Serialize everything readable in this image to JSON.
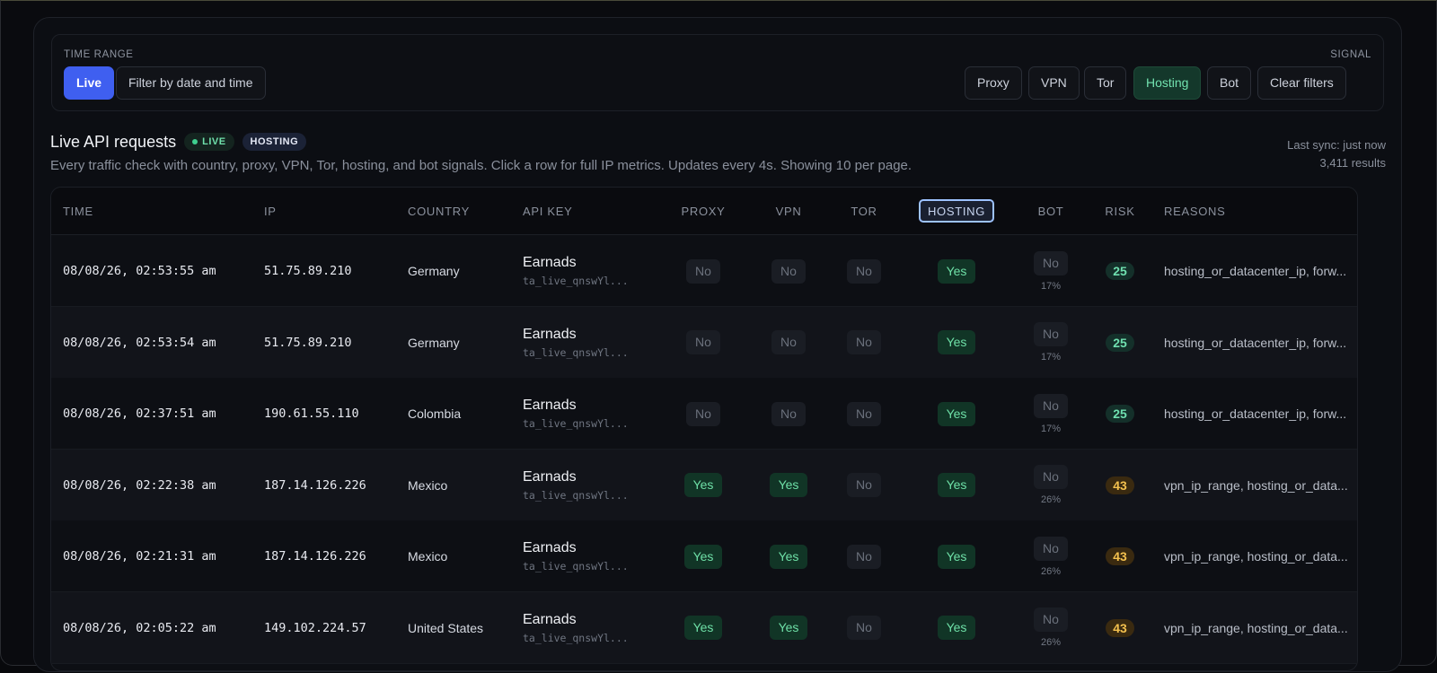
{
  "filters": {
    "time_range_label": "TIME RANGE",
    "signal_label": "SIGNAL",
    "live_button": "Live",
    "date_button": "Filter by date and time",
    "signals": [
      "Proxy",
      "VPN",
      "Tor",
      "Hosting",
      "Bot"
    ],
    "active_signal": "Hosting",
    "clear_button": "Clear filters"
  },
  "header": {
    "title": "Live API requests",
    "live_pill": "LIVE",
    "filter_pill": "HOSTING",
    "description": "Every traffic check with country, proxy, VPN, Tor, hosting, and bot signals. Click a row for full IP metrics. Updates every 4s. Showing 10 per page.",
    "last_sync": "Last sync: just now",
    "result_count": "3,411 results"
  },
  "table": {
    "columns": [
      "TIME",
      "IP",
      "COUNTRY",
      "API KEY",
      "PROXY",
      "VPN",
      "TOR",
      "HOSTING",
      "BOT",
      "RISK",
      "REASONS"
    ],
    "rows": [
      {
        "time": "08/08/26, 02:53:55 am",
        "ip": "51.75.89.210",
        "country": "Germany",
        "key_name": "Earnads",
        "key_id": "ta_live_qnswYl...",
        "proxy": "No",
        "vpn": "No",
        "tor": "No",
        "hosting": "Yes",
        "bot": "No",
        "bot_pct": "17%",
        "risk": "25",
        "reasons": "hosting_or_datacenter_ip, forw..."
      },
      {
        "time": "08/08/26, 02:53:54 am",
        "ip": "51.75.89.210",
        "country": "Germany",
        "key_name": "Earnads",
        "key_id": "ta_live_qnswYl...",
        "proxy": "No",
        "vpn": "No",
        "tor": "No",
        "hosting": "Yes",
        "bot": "No",
        "bot_pct": "17%",
        "risk": "25",
        "reasons": "hosting_or_datacenter_ip, forw..."
      },
      {
        "time": "08/08/26, 02:37:51 am",
        "ip": "190.61.55.110",
        "country": "Colombia",
        "key_name": "Earnads",
        "key_id": "ta_live_qnswYl...",
        "proxy": "No",
        "vpn": "No",
        "tor": "No",
        "hosting": "Yes",
        "bot": "No",
        "bot_pct": "17%",
        "risk": "25",
        "reasons": "hosting_or_datacenter_ip, forw..."
      },
      {
        "time": "08/08/26, 02:22:38 am",
        "ip": "187.14.126.226",
        "country": "Mexico",
        "key_name": "Earnads",
        "key_id": "ta_live_qnswYl...",
        "proxy": "Yes",
        "vpn": "Yes",
        "tor": "No",
        "hosting": "Yes",
        "bot": "No",
        "bot_pct": "26%",
        "risk": "43",
        "reasons": "vpn_ip_range, hosting_or_data..."
      },
      {
        "time": "08/08/26, 02:21:31 am",
        "ip": "187.14.126.226",
        "country": "Mexico",
        "key_name": "Earnads",
        "key_id": "ta_live_qnswYl...",
        "proxy": "Yes",
        "vpn": "Yes",
        "tor": "No",
        "hosting": "Yes",
        "bot": "No",
        "bot_pct": "26%",
        "risk": "43",
        "reasons": "vpn_ip_range, hosting_or_data..."
      },
      {
        "time": "08/08/26, 02:05:22 am",
        "ip": "149.102.224.57",
        "country": "United States",
        "key_name": "Earnads",
        "key_id": "ta_live_qnswYl...",
        "proxy": "Yes",
        "vpn": "Yes",
        "tor": "No",
        "hosting": "Yes",
        "bot": "No",
        "bot_pct": "26%",
        "risk": "43",
        "reasons": "vpn_ip_range, hosting_or_data..."
      }
    ]
  },
  "colors": {
    "accent": "#3f5ff0",
    "yes": "#6ee0a7",
    "risk_low": "#6fe0b0",
    "risk_mid": "#f3c04e"
  }
}
